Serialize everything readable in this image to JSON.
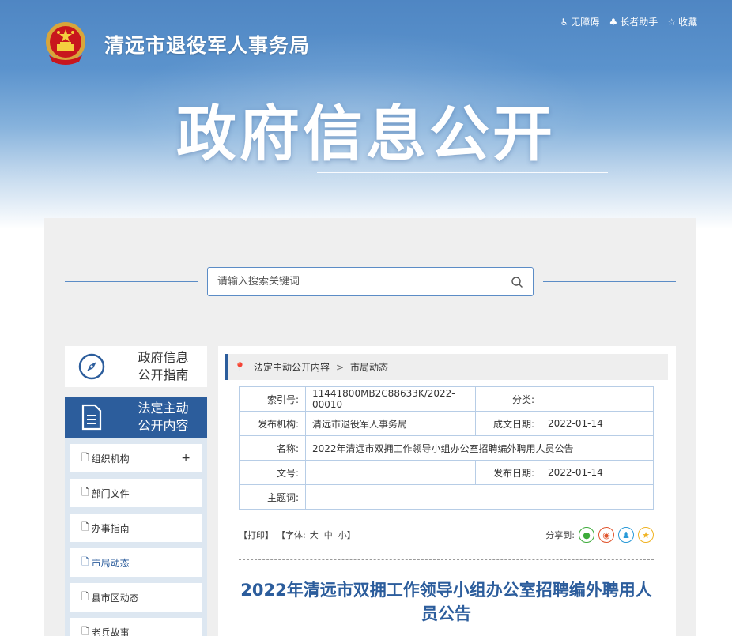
{
  "header": {
    "site_title": "清远市退役军人事务局",
    "links": [
      {
        "icon": "accessibility-icon",
        "label": "无障碍"
      },
      {
        "icon": "elder-helper-icon",
        "label": "长者助手"
      },
      {
        "icon": "star-icon",
        "label": "收藏"
      }
    ],
    "hero_title": "政府信息公开"
  },
  "search": {
    "placeholder": "请输入搜索关键词"
  },
  "sidebar": {
    "guide_card": {
      "icon": "compass-icon",
      "line1": "政府信息",
      "line2": "公开指南"
    },
    "main_card": {
      "icon": "document-icon",
      "line1": "法定主动",
      "line2": "公开内容"
    },
    "items": [
      {
        "label": "组织机构",
        "has_expand": true,
        "expand_label": "+"
      },
      {
        "label": "部门文件"
      },
      {
        "label": "办事指南"
      },
      {
        "label": "市局动态",
        "active": true
      },
      {
        "label": "县市区动态"
      },
      {
        "label": "老兵故事"
      }
    ]
  },
  "breadcrumb": {
    "items": [
      "法定主动公开内容",
      "市局动态"
    ],
    "separator": ">"
  },
  "meta": {
    "index_label": "索引号:",
    "index_value": "11441800MB2C88633K/2022-00010",
    "category_label": "分类:",
    "category_value": "",
    "publisher_label": "发布机构:",
    "publisher_value": "清远市退役军人事务局",
    "created_label": "成文日期:",
    "created_value": "2022-01-14",
    "name_label": "名称:",
    "name_value": "2022年清远市双拥工作领导小组办公室招聘编外聘用人员公告",
    "docno_label": "文号:",
    "docno_value": "",
    "published_label": "发布日期:",
    "published_value": "2022-01-14",
    "subject_label": "主题词:",
    "subject_value": ""
  },
  "tools": {
    "print": "【打印】",
    "font_prefix": "【字体:",
    "font_large": "大",
    "font_medium": "中",
    "font_small": "小",
    "font_suffix": "】",
    "share_label": "分享到:",
    "share_icons": [
      "wechat-icon",
      "weibo-icon",
      "qq-icon",
      "qzone-icon"
    ]
  },
  "article": {
    "title": "2022年清远市双拥工作领导小组办公室招聘编外聘用人员公告"
  },
  "colors": {
    "brand": "#2c5d9c",
    "panel": "#efefef",
    "accent_line": "#5b8cc6"
  }
}
